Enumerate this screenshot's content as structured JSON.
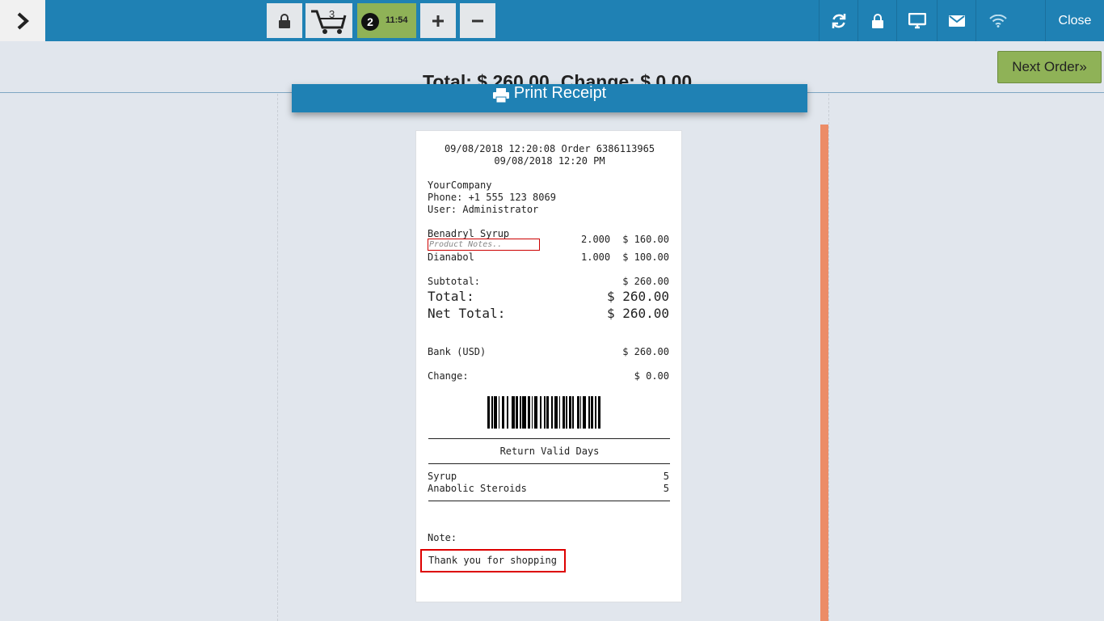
{
  "topbar": {
    "toggle_icon": "chevron-right-icon",
    "cart_count": "3",
    "order_number": "2",
    "order_time": "11:54",
    "close_label": "Close"
  },
  "summary": {
    "total": "Total: $ 260.00",
    "change": "Change: $ 0.00",
    "next_order": "Next Order»"
  },
  "print_button": "Print Receipt",
  "receipt": {
    "header_line1": "09/08/2018 12:20:08 Order 6386113965",
    "header_line2": "09/08/2018 12:20 PM",
    "company": "YourCompany",
    "phone": "Phone: +1 555 123 8069",
    "user": "User: Administrator",
    "lines": [
      {
        "name": "Benadryl Syrup",
        "qty": "2.000",
        "price": "$ 160.00",
        "note_placeholder": "Product Notes.."
      },
      {
        "name": "Dianabol",
        "qty": "1.000",
        "price": "$ 100.00"
      }
    ],
    "subtotal_label": "Subtotal:",
    "subtotal_value": "$ 260.00",
    "total_label": "Total:",
    "total_value": "$ 260.00",
    "net_total_label": "Net Total:",
    "net_total_value": "$ 260.00",
    "payment_label": "Bank (USD)",
    "payment_value": "$ 260.00",
    "change_label": "Change:",
    "change_value": "$ 0.00",
    "return_title": "Return Valid Days",
    "return_items": [
      {
        "name": "Syrup",
        "days": "5"
      },
      {
        "name": "Anabolic Steroids",
        "days": "5"
      }
    ],
    "note_label": "Note:",
    "note_text": "Thank you for shopping"
  },
  "colors": {
    "topbar": "#1f81b4",
    "order_badge": "#8fb257",
    "next_button": "#8fb257",
    "scrollbar": "#ec8c67",
    "highlight": "#dd0000"
  }
}
